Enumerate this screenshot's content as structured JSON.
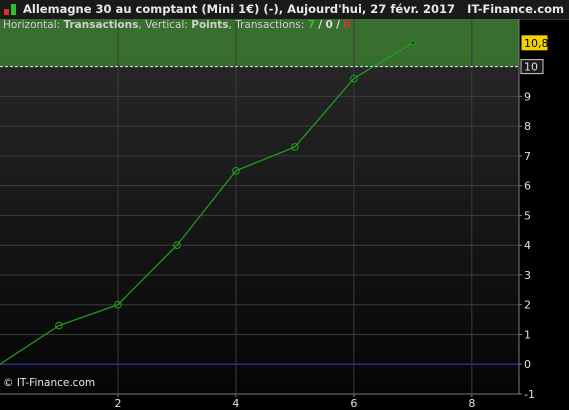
{
  "window": {
    "title": "Allemagne 30 au comptant (Mini 1€) (-), Aujourd'hui, 27 févr. 2017",
    "brand": "IT-Finance.com"
  },
  "info": {
    "horizontal_label": "Horizontal:",
    "horizontal_value": "Transactions",
    "sep1": ",",
    "vertical_label": "Vertical:",
    "vertical_value": "Points",
    "sep2": ",",
    "transactions_label": "Transactions:",
    "count_total": "7",
    "slash1": "/",
    "count_neutral": "0",
    "slash2": "/",
    "count_loss": "0"
  },
  "copyright": "© IT-Finance.com",
  "colors": {
    "background_top": "#2b2b2b",
    "background_bottom": "#050505",
    "line": "#1fa31f",
    "target_zone": "#3b7a2f",
    "zero_line": "#2a2ad8",
    "badge": "#f3d400"
  },
  "chart_data": {
    "type": "line",
    "title": "",
    "xlabel": "Transactions",
    "ylabel": "Points",
    "x": [
      0,
      1,
      2,
      3,
      4,
      5,
      6,
      7
    ],
    "y": [
      0,
      1.3,
      2,
      4,
      6.5,
      7.3,
      9.6,
      10.8
    ],
    "xlim": [
      0,
      8.8
    ],
    "ylim": [
      -1,
      11.6
    ],
    "x_ticks": [
      "2",
      "4",
      "6",
      "8"
    ],
    "y_ticks": [
      "-1",
      "0",
      "1",
      "2",
      "3",
      "4",
      "5",
      "6",
      "7",
      "8",
      "9",
      "10"
    ],
    "grid": true,
    "target_line": {
      "value": 10,
      "label": "10"
    },
    "current_value": {
      "value": 10.8,
      "label": "10,8"
    },
    "zero_line": 0
  }
}
